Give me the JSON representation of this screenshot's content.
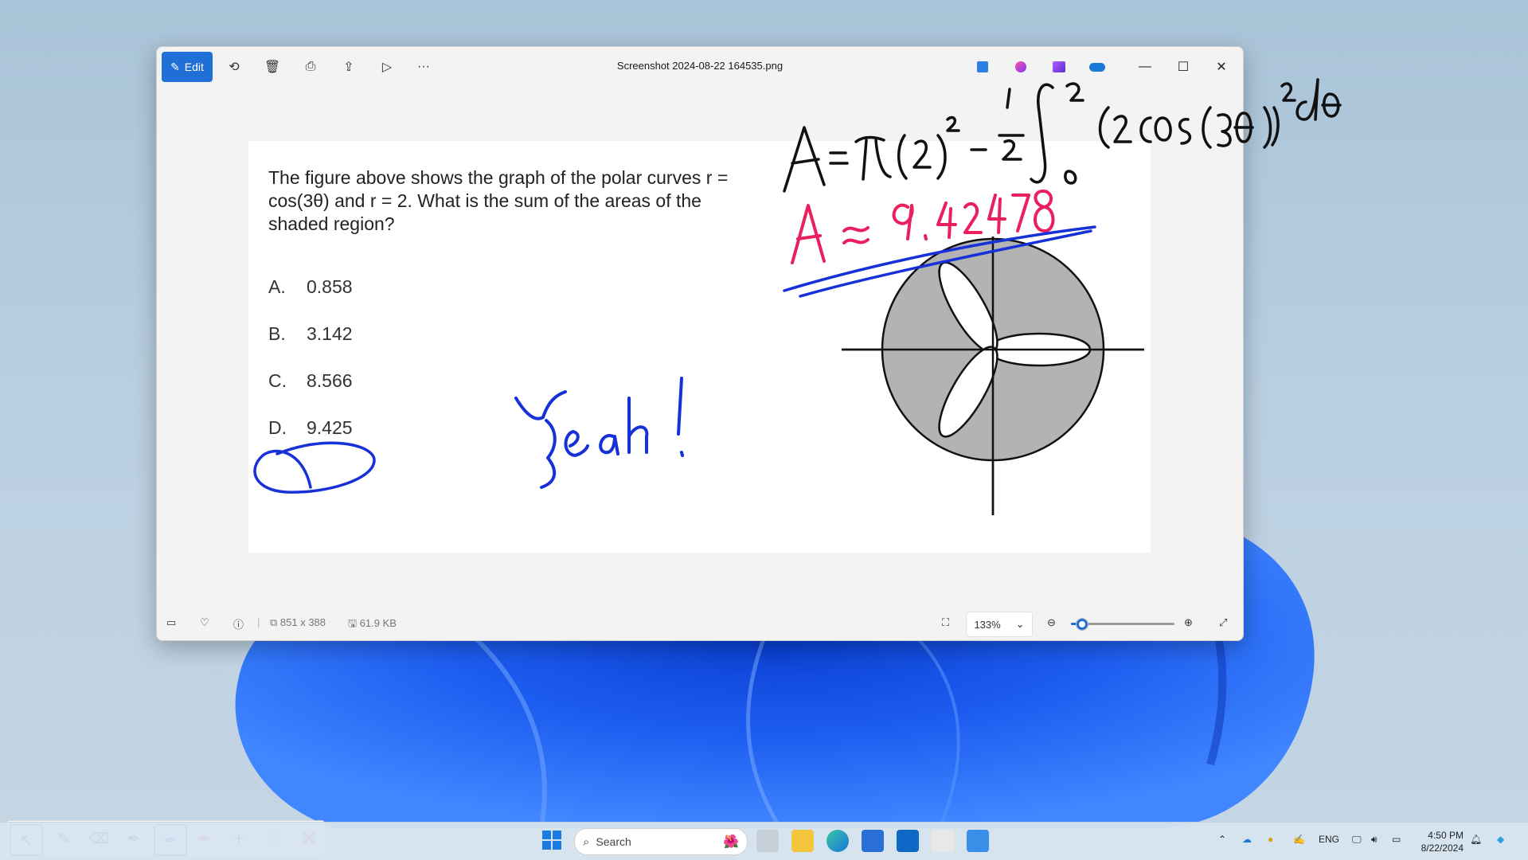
{
  "window": {
    "title": "Screenshot 2024-08-22 164535.png",
    "edit_label": "Edit"
  },
  "document": {
    "question": "The figure above shows the graph of the polar curves r = cos(3θ) and r = 2. What is the sum of the areas of the shaded region?",
    "options": [
      {
        "letter": "A.",
        "value": "0.858"
      },
      {
        "letter": "B.",
        "value": "3.142"
      },
      {
        "letter": "C.",
        "value": "8.566"
      },
      {
        "letter": "D.",
        "value": "9.425"
      }
    ]
  },
  "ink": {
    "formula": "A=π(2)² − ½ ∫₀^π (2cos(3θ))² dθ",
    "result": "A ≈ 9.42478",
    "exclamation": "Yeah!"
  },
  "statusbar": {
    "dimensions": "851 x 388",
    "filesize": "61.9 KB",
    "zoom": "133%",
    "zoom_fraction": 0.1
  },
  "taskbar": {
    "search_placeholder": "Search",
    "language": "ENG",
    "time": "4:50 PM",
    "date": "8/22/2024"
  },
  "colors": {
    "accent": "#1f6fd6",
    "ink_blue": "#1631d8",
    "ink_red": "#ea1f5e",
    "ink_black": "#111111"
  }
}
